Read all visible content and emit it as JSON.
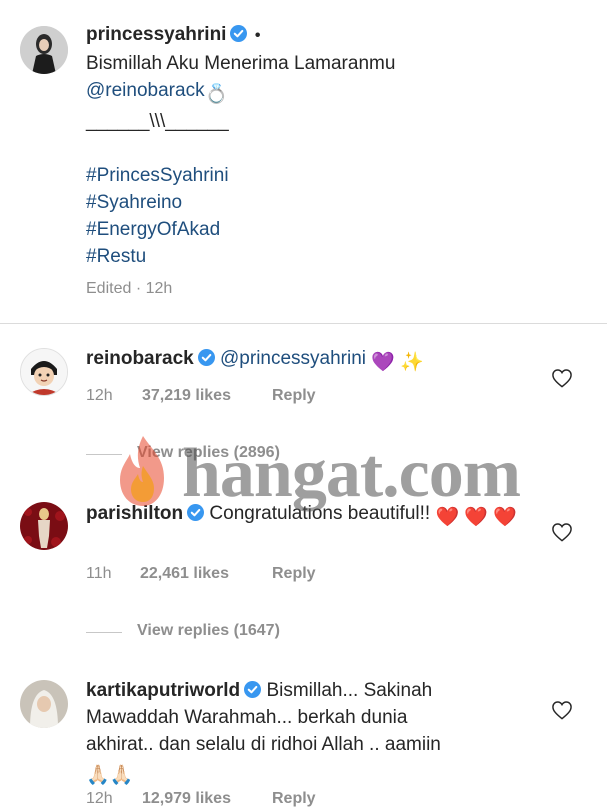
{
  "post": {
    "username": "princessyahrini",
    "dot": "•",
    "line1": "Bismillah Aku Menerima Lamaranmu",
    "mention": "@reinobarack",
    "ring_emoji": "💍",
    "decor": "______\\\\\\______",
    "hashtags": [
      "#PrincesSyahrini",
      "#Syahreino",
      "#EnergyOfAkad",
      "#Restu"
    ],
    "edited": "Edited · 12h"
  },
  "comments": [
    {
      "username": "reinobarack",
      "text": "@princessyahrini",
      "emojis": "💜 ✨",
      "time": "12h",
      "likes": "37,219 likes",
      "reply": "Reply",
      "view_replies": "View replies (2896)"
    },
    {
      "username": "parishilton",
      "text": "Congratulations beautiful!!",
      "emojis": "❤️ ❤️ ❤️",
      "time": "11h",
      "likes": "22,461 likes",
      "reply": "Reply",
      "view_replies": "View replies (1647)"
    },
    {
      "username": "kartikaputriworld",
      "text_line1": "Bismillah... Sakinah",
      "text_line2": "Mawaddah Warahmah... berkah dunia",
      "text_line3": "akhirat.. dan selalu di ridhoi Allah .. aamiin",
      "emojis": "🙏🏻🙏🏻",
      "time": "12h",
      "likes": "12,979 likes",
      "reply": "Reply"
    }
  ],
  "watermark": {
    "text": "hangat.com"
  },
  "colors": {
    "link": "#1f4e7d",
    "verified": "#3897f0",
    "muted": "#8e8e8e"
  }
}
